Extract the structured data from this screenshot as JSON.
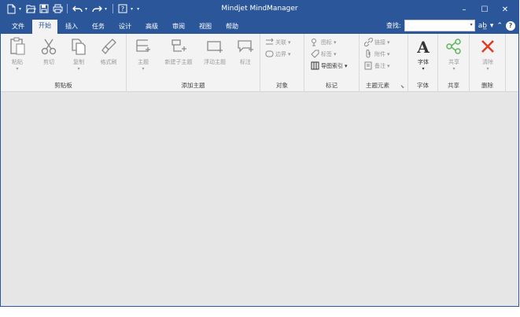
{
  "app": {
    "title": "Mindjet MindManager"
  },
  "tabs": [
    "文件",
    "开始",
    "插入",
    "任务",
    "设计",
    "高级",
    "审阅",
    "视图",
    "帮助"
  ],
  "active_tab": "开始",
  "search": {
    "label": "查找:",
    "value": ""
  },
  "ribbon": {
    "clipboard": {
      "group_label": "剪贴板",
      "paste": "粘贴",
      "cut": "剪切",
      "copy": "复制",
      "format_painter": "格式刷"
    },
    "add_topic": {
      "group_label": "添加主题",
      "topic": "主题",
      "new_subtopic": "新建子主题",
      "floating_topic": "浮动主题",
      "callout": "标注"
    },
    "objects": {
      "group_label": "对象",
      "relationship": "关联",
      "boundary": "边界"
    },
    "markers": {
      "group_label": "标记",
      "icons": "图标",
      "tags": "标签",
      "map_index": "导图索引"
    },
    "topic_elements": {
      "group_label": "主题元素",
      "link": "链接",
      "attachment": "附件",
      "notes": "备注"
    },
    "font": {
      "group_label": "字体",
      "font": "字体"
    },
    "share": {
      "group_label": "共享",
      "share": "共享"
    },
    "delete": {
      "group_label": "删除",
      "clear": "清除"
    }
  },
  "icons": {
    "qat": [
      "new-icon",
      "open-icon",
      "save-icon",
      "print-icon",
      "undo-icon",
      "redo-icon",
      "help-frame-icon"
    ],
    "window": [
      "minimize-icon",
      "maximize-icon",
      "close-icon"
    ]
  },
  "colors": {
    "title_bar": "#2b579a",
    "ribbon_bg": "#f3f3f3",
    "canvas_bg": "#e6e6e6",
    "accent_red": "#e03b24",
    "accent_green": "#5cb85c"
  }
}
